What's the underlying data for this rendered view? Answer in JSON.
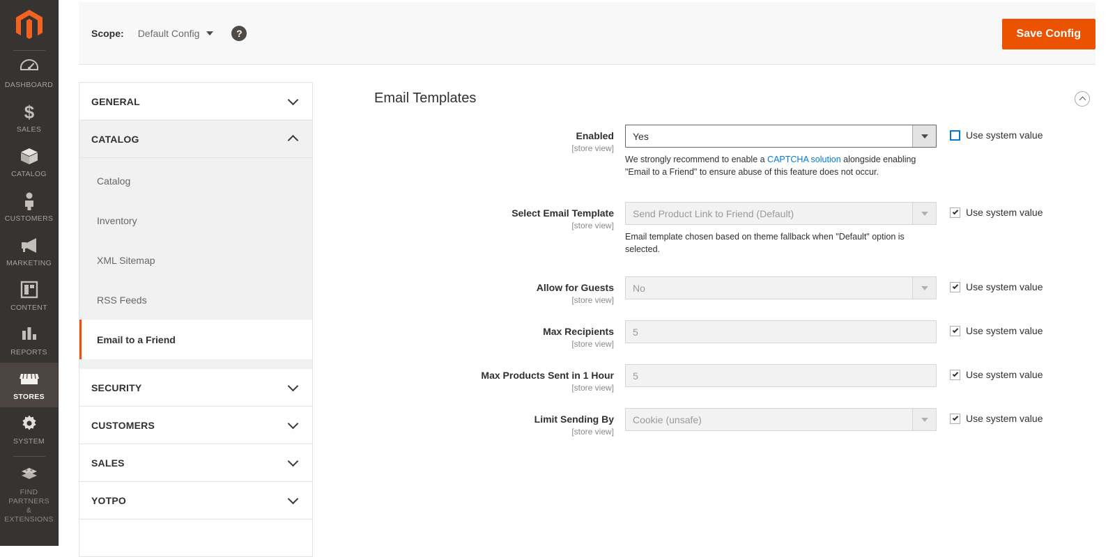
{
  "admin_nav": {
    "logo": "magento-logo-icon",
    "items": [
      {
        "label": "DASHBOARD",
        "icon": "dashboard-gauge-icon",
        "active": false
      },
      {
        "label": "SALES",
        "icon": "dollar-sign-icon",
        "active": false
      },
      {
        "label": "CATALOG",
        "icon": "box-icon",
        "active": false
      },
      {
        "label": "CUSTOMERS",
        "icon": "person-icon",
        "active": false
      },
      {
        "label": "MARKETING",
        "icon": "megaphone-icon",
        "active": false
      },
      {
        "label": "CONTENT",
        "icon": "layout-window-icon",
        "active": false
      },
      {
        "label": "REPORTS",
        "icon": "bar-chart-icon",
        "active": false
      },
      {
        "label": "STORES",
        "icon": "storefront-icon",
        "active": true
      },
      {
        "label": "SYSTEM",
        "icon": "gear-icon",
        "active": false
      },
      {
        "label": "FIND PARTNERS\n& EXTENSIONS",
        "icon": "lego-block-icon",
        "active": false
      }
    ]
  },
  "header": {
    "scope_label": "Scope:",
    "scope_value": "Default Config",
    "help_icon": "question-mark-icon",
    "save_label": "Save Config",
    "accent_color": "#eb5202"
  },
  "config_nav": {
    "sections": [
      {
        "title": "GENERAL",
        "open": false,
        "children": []
      },
      {
        "title": "CATALOG",
        "open": true,
        "children": [
          {
            "label": "Catalog",
            "active": false
          },
          {
            "label": "Inventory",
            "active": false
          },
          {
            "label": "XML Sitemap",
            "active": false
          },
          {
            "label": "RSS Feeds",
            "active": false
          },
          {
            "label": "Email to a Friend",
            "active": true
          }
        ]
      },
      {
        "title": "SECURITY",
        "open": false,
        "children": []
      },
      {
        "title": "CUSTOMERS",
        "open": false,
        "children": []
      },
      {
        "title": "SALES",
        "open": false,
        "children": []
      },
      {
        "title": "YOTPO",
        "open": false,
        "children": []
      }
    ]
  },
  "content": {
    "section_title": "Email Templates",
    "collapse_icon": "chevron-up-circle-icon",
    "scope_note": "[store view]",
    "system_value_label": "Use system value",
    "fields": [
      {
        "label": "Enabled",
        "scope": "[store view]",
        "control": "select",
        "value": "Yes",
        "disabled": false,
        "focus": true,
        "note_before": "We strongly recommend to enable a ",
        "note_link": "CAPTCHA solution",
        "note_after": " alongside enabling \"Email to a Friend\" to ensure abuse of this feature does not occur.",
        "system_value_checked": false,
        "system_value_focused": true
      },
      {
        "label": "Select Email Template",
        "scope": "[store view]",
        "control": "select",
        "value": "Send Product Link to Friend (Default)",
        "disabled": true,
        "focus": false,
        "note_before": "Email template chosen based on theme fallback when \"Default\" option is selected.",
        "note_link": "",
        "note_after": "",
        "system_value_checked": true,
        "system_value_focused": false
      },
      {
        "label": "Allow for Guests",
        "scope": "[store view]",
        "control": "select",
        "value": "No",
        "disabled": true,
        "focus": false,
        "note_before": "",
        "note_link": "",
        "note_after": "",
        "system_value_checked": true,
        "system_value_focused": false
      },
      {
        "label": "Max Recipients",
        "scope": "[store view]",
        "control": "text",
        "value": "5",
        "disabled": true,
        "focus": false,
        "note_before": "",
        "note_link": "",
        "note_after": "",
        "system_value_checked": true,
        "system_value_focused": false
      },
      {
        "label": "Max Products Sent in 1 Hour",
        "scope": "[store view]",
        "control": "text",
        "value": "5",
        "disabled": true,
        "focus": false,
        "note_before": "",
        "note_link": "",
        "note_after": "",
        "system_value_checked": true,
        "system_value_focused": false
      },
      {
        "label": "Limit Sending By",
        "scope": "[store view]",
        "control": "select",
        "value": "Cookie (unsafe)",
        "disabled": true,
        "focus": false,
        "note_before": "",
        "note_link": "",
        "note_after": "",
        "system_value_checked": true,
        "system_value_focused": false
      }
    ]
  }
}
